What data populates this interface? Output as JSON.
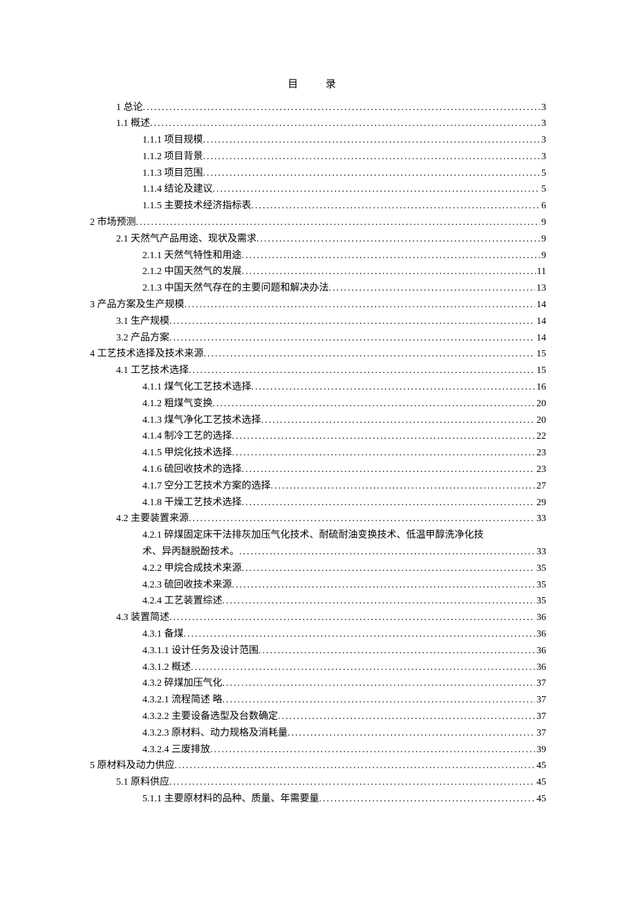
{
  "title": "目   录",
  "entries": [
    {
      "level": 1,
      "text": "1 总论",
      "page": "3"
    },
    {
      "level": 1,
      "text": "1.1 概述",
      "page": "3"
    },
    {
      "level": 2,
      "text": "1.1.1 项目规模",
      "page": "3"
    },
    {
      "level": 2,
      "text": "1.1.2 项目背景",
      "page": "3"
    },
    {
      "level": 2,
      "text": "1.1.3 项目范围",
      "page": "5"
    },
    {
      "level": 2,
      "text": "1.1.4 结论及建议",
      "page": "5"
    },
    {
      "level": 2,
      "text": "1.1.5 主要技术经济指标表",
      "page": "6"
    },
    {
      "level": 0,
      "text": "2 市场预测",
      "page": "9"
    },
    {
      "level": 1,
      "text": "2.1 天然气产品用途、现状及需求",
      "page": "9"
    },
    {
      "level": 2,
      "text": "2.1.1 天然气特性和用途",
      "page": "9"
    },
    {
      "level": 2,
      "text": "2.1.2 中国天然气的发展",
      "page": "11"
    },
    {
      "level": 2,
      "text": "2.1.3 中国天然气存在的主要问题和解决办法",
      "page": "13"
    },
    {
      "level": 0,
      "text": "3 产品方案及生产规模",
      "page": "14"
    },
    {
      "level": 1,
      "text": "3.1 生产规模",
      "page": "14"
    },
    {
      "level": 1,
      "text": "3.2 产品方案",
      "page": "14"
    },
    {
      "level": 0,
      "text": "4 工艺技术选择及技术来源",
      "page": "15"
    },
    {
      "level": 1,
      "text": "4.1 工艺技术选择",
      "page": "15"
    },
    {
      "level": 2,
      "text": "4.1.1 煤气化工艺技术选择",
      "page": "16"
    },
    {
      "level": 2,
      "text": "4.1.2 粗煤气变换",
      "page": "20"
    },
    {
      "level": 2,
      "text": "4.1.3 煤气净化工艺技术选择",
      "page": "20"
    },
    {
      "level": 2,
      "text": "4.1.4 制冷工艺的选择",
      "page": "22"
    },
    {
      "level": 2,
      "text": "4.1.5 甲烷化技术选择",
      "page": "23"
    },
    {
      "level": 2,
      "text": "4.1.6 硫回收技术的选择",
      "page": "23"
    },
    {
      "level": 2,
      "text": "4.1.7 空分工艺技术方案的选择",
      "page": "27"
    },
    {
      "level": 2,
      "text": "4.1.8 干燥工艺技术选择",
      "page": "29"
    },
    {
      "level": 1,
      "text": "4.2 主要装置来源",
      "page": "33"
    },
    {
      "level": 2,
      "text": "4.2.1 碎煤固定床干法排灰加压气化技术、耐硫耐油变换技术、低温甲醇洗净化技术、异丙醚脱酚技术。",
      "page": "33"
    },
    {
      "level": 2,
      "text": "4.2.2 甲烷合成技术来源",
      "page": "35"
    },
    {
      "level": 2,
      "text": "4.2.3 硫回收技术来源",
      "page": "35"
    },
    {
      "level": 2,
      "text": "4.2.4 工艺装置综述",
      "page": "35"
    },
    {
      "level": 1,
      "text": "4.3 装置简述",
      "page": "36"
    },
    {
      "level": 2,
      "text": "4.3.1 备煤",
      "page": "36"
    },
    {
      "level": 2,
      "text": "4.3.1.1 设计任务及设计范围",
      "page": "36"
    },
    {
      "level": 2,
      "text": "4.3.1.2 概述",
      "page": "36"
    },
    {
      "level": 2,
      "text": "4.3.2 碎煤加压气化",
      "page": "37"
    },
    {
      "level": 2,
      "text": "4.3.2.1 流程简述  略",
      "page": "37"
    },
    {
      "level": 2,
      "text": "4.3.2.2 主要设备选型及台数确定",
      "page": "37"
    },
    {
      "level": 2,
      "text": "4.3.2.3 原材料、动力规格及消耗量",
      "page": "37"
    },
    {
      "level": 2,
      "text": "4.3.2.4 三废排放",
      "page": "39"
    },
    {
      "level": 0,
      "text": "5  原材料及动力供应",
      "page": "45"
    },
    {
      "level": 1,
      "text": "5.1 原料供应",
      "page": "45"
    },
    {
      "level": 2,
      "text": "5.1.1 主要原材料的品种、质量、年需要量",
      "page": "45"
    }
  ]
}
